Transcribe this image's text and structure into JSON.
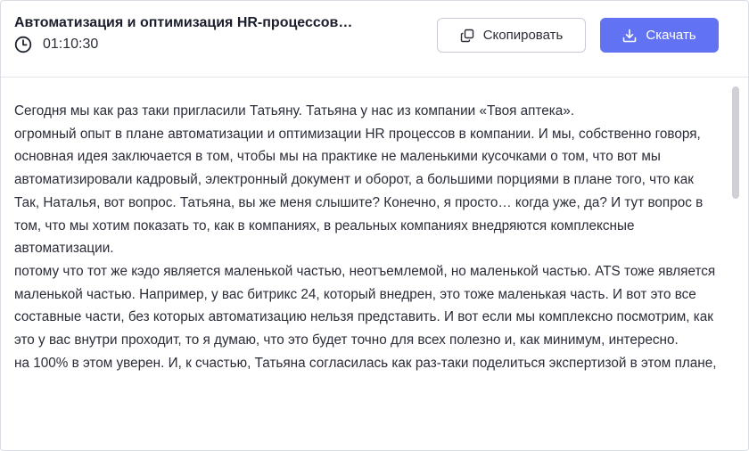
{
  "header": {
    "title": "Автоматизация и оптимизация HR-процессов…",
    "duration": "01:10:30",
    "copy_label": "Скопировать",
    "download_label": "Скачать"
  },
  "icons": {
    "duration": "clock-icon",
    "copy": "copy-icon",
    "download": "download-icon"
  },
  "colors": {
    "accent": "#6173f2",
    "text": "#2a2d38",
    "border": "#d9dce3"
  },
  "transcript": {
    "paragraphs": [
      "Сегодня мы как раз таки пригласили Татьяну. Татьяна у нас из компании «Твоя аптека».",
      "огромный опыт в плане автоматизации и оптимизации HR процессов в компании. И мы, собственно говоря, основная идея заключается в том, чтобы мы на практике не маленькими кусочками о том, что вот мы автоматизировали кадровый, электронный документ и оборот, а большими порциями в плане того, что как",
      "Так, Наталья, вот вопрос. Татьяна, вы же меня слышите? Конечно, я просто… когда уже, да? И тут вопрос в том, что мы хотим показать то, как в компаниях, в реальных компаниях внедряются комплексные автоматизации.",
      "потому что тот же кэдо является маленькой частью, неотъемлемой, но маленькой частью. ATS тоже является маленькой частью. Например, у вас битрикс 24, который внедрен, это тоже маленькая часть. И вот это все составные части, без которых автоматизацию нельзя представить. И вот если мы комплексно посмотрим, как это у вас внутри проходит, то я думаю, что это будет точно для всех полезно и, как минимум, интересно.",
      "на 100% в этом уверен. И, к счастью, Татьяна согласилась как раз-таки поделиться экспертизой в этом плане,"
    ]
  }
}
